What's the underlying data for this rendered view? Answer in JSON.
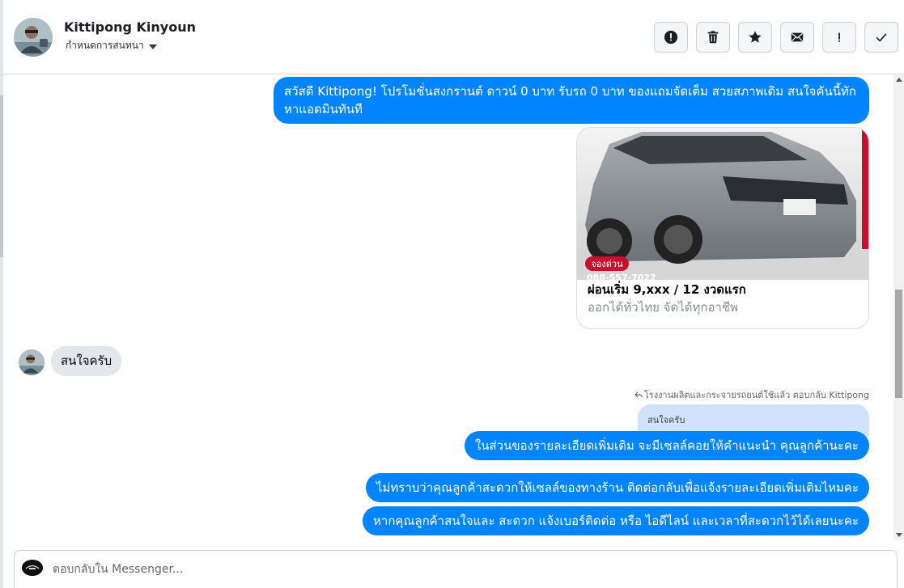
{
  "header": {
    "contact_name": "Kittipong Kinyoun",
    "assign_label": "กำหนดการสนทนา",
    "toolbar": {
      "spam_icon": "alert-circle-icon",
      "delete_icon": "trash-icon",
      "star_icon": "star-icon",
      "unread_icon": "mail-icon",
      "priority_icon": "exclamation-icon",
      "done_icon": "check-icon"
    }
  },
  "messages": {
    "outgoing_1": "สวัสดี Kittipong! โปรโมชั่นสงกรานต์ ดาวน์ 0 บาท รับรถ 0 บาท ของแถมจัดเต็ม สวยสภาพเดิม สนใจคันนี้ทักหาแอดมินทันที",
    "card": {
      "image_badge": "จองด่วน",
      "image_phone": "088-557-7022",
      "title": "ผ่อนเริ่ม 9,xxx / 12 งวดแรก",
      "subtitle": "ออกได้ทั่วไทย จัดได้ทุกอาชีพ"
    },
    "incoming_1": "สนใจครับ",
    "reply_meta": "โรงงานผลิตและกระจายรถยนต์ใช้แล้ว ตอบกลับ Kittipong",
    "quoted_text": "สนใจครับ",
    "outgoing_2": "ในส่วนของรายละเอียดเพิ่มเติม จะมีเซลล์คอยให้คำแนะนำ คุณลูกค้านะคะ",
    "outgoing_3": "ไม่ทราบว่าคุณลูกค้าสะดวกให้เซลล์ของทางร้าน ติดต่อกลับเพื่อแจ้งรายละเอียดเพิ่มเติมไหมคะ",
    "outgoing_4": "หากคุณลูกค้าสนใจและ สะดวก แจ้งเบอร์ติดต่อ หรือ ไอดีไลน์ และเวลาที่สะดวกไว้ได้เลยนะคะ"
  },
  "composer": {
    "placeholder": "ตอบกลับใน Messenger..."
  },
  "colors": {
    "outgoing_bubble": "#0084ff",
    "incoming_bubble": "#e4e6eb",
    "quoted_bubble": "#cfe3fd"
  }
}
